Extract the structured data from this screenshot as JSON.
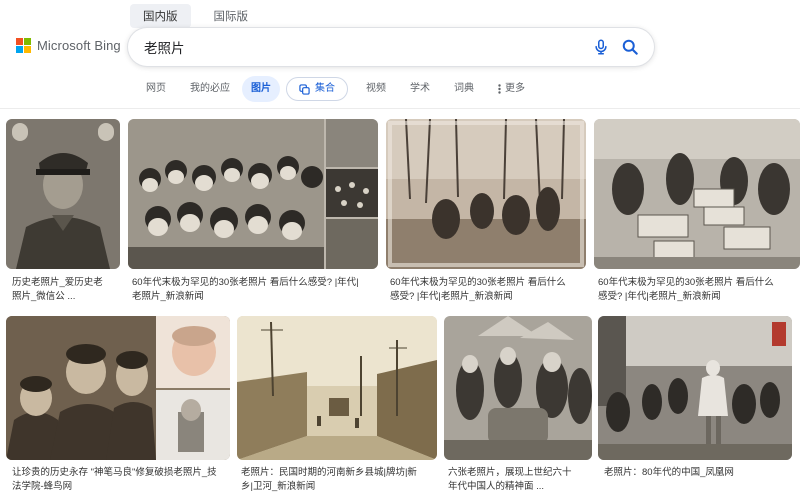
{
  "region_tabs": [
    "国内版",
    "国际版"
  ],
  "logo": {
    "text": "Microsoft Bing",
    "colors": [
      "#f25022",
      "#7fba00",
      "#00a4ef",
      "#ffb900"
    ]
  },
  "search": {
    "query": "老照片",
    "accent": "#1a5fd6"
  },
  "nav": {
    "items": [
      "网页",
      "我的必应",
      "图片",
      "集合",
      "视频",
      "学术",
      "词典",
      "更多"
    ],
    "active": "图片"
  },
  "results": [
    {
      "caption": [
        "历史老照片_爱历史老",
        "照片_微信公 ..."
      ]
    },
    {
      "caption": [
        "60年代末极为罕见的30张老照片 看后什么感受? |年代|",
        "老照片_新浪新闻"
      ]
    },
    {
      "caption": [
        "60年代末极为罕见的30张老照片 看后什么",
        "感受? |年代|老照片_新浪新闻"
      ]
    },
    {
      "caption": [
        "60年代末极为罕见的30张老照片 看后什么",
        "感受? |年代|老照片_新浪新闻"
      ]
    },
    {
      "caption": [
        "让珍贵的历史永存 \"神笔马良\"修复破损老照片_技",
        "法学院-蜂鸟网"
      ]
    },
    {
      "caption": [
        "老照片：民国时期的河南新乡县城|牌坊|新",
        "乡|卫河_新浪新闻"
      ]
    },
    {
      "caption": [
        "六张老照片，展现上世纪六十",
        "年代中国人的精神面 ..."
      ]
    },
    {
      "caption": [
        "老照片：80年代的中国_凤凰网"
      ]
    }
  ]
}
